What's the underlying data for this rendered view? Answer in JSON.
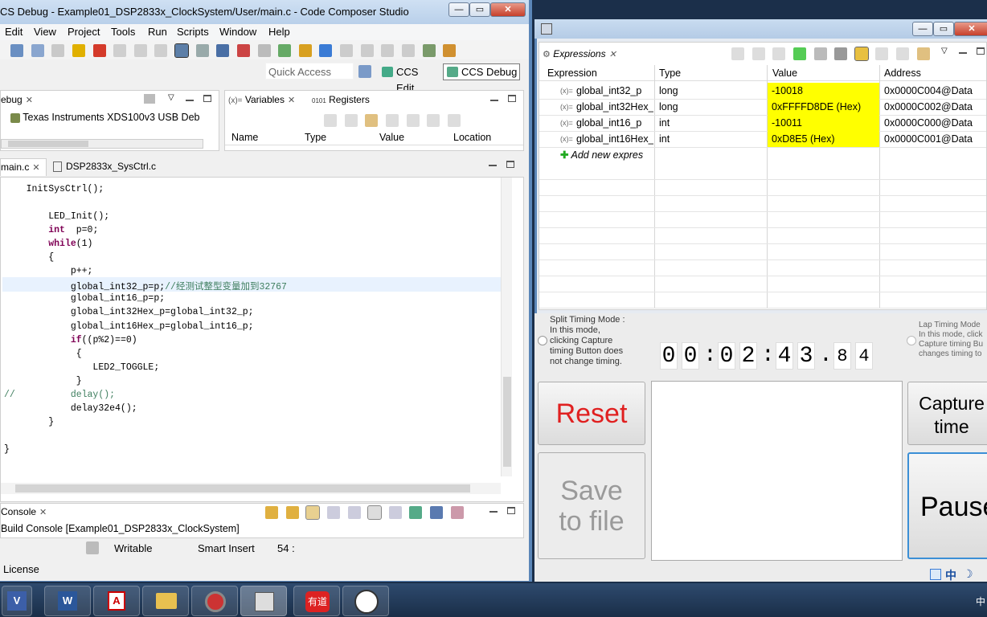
{
  "ccs": {
    "title": "CS Debug - Example01_DSP2833x_ClockSystem/User/main.c - Code Composer Studio",
    "menu": [
      "Edit",
      "View",
      "Project",
      "Tools",
      "Run",
      "Scripts",
      "Window",
      "Help"
    ],
    "quick_access": "Quick Access",
    "perspectives": [
      "CCS Edit",
      "CCS Debug"
    ],
    "debug_view": {
      "tab": "ebug",
      "target": "Texas Instruments XDS100v3 USB Deb"
    },
    "variables_view": {
      "tabs": [
        "Variables",
        "Registers"
      ],
      "columns": [
        "Name",
        "Type",
        "Value",
        "Location"
      ]
    },
    "editor": {
      "tabs": [
        "main.c",
        "DSP2833x_SysCtrl.c"
      ],
      "lines": [
        "    InitSysCtrl();",
        "",
        "        LED_Init();",
        "        int  p=0;",
        "        while(1)",
        "        {",
        "            p++;",
        "            global_int32_p=p;//经测试整型变量加到32767",
        "            global_int16_p=p;",
        "            global_int32Hex_p=global_int32_p;",
        "            global_int16Hex_p=global_int16_p;",
        "            if((p%2)==0)",
        "             {",
        "                LED2_TOGGLE;",
        "             }",
        "//          delay();",
        "            delay32e4();",
        "        }",
        "",
        "}"
      ]
    },
    "console": {
      "tab": "Console",
      "text": "Build Console [Example01_DSP2833x_ClockSystem]"
    },
    "status": {
      "writable": "Writable",
      "insert": "Smart Insert",
      "pos": "54 :",
      "license": "License"
    }
  },
  "expressions": {
    "tab": "Expressions",
    "columns": [
      "Expression",
      "Type",
      "Value",
      "Address"
    ],
    "rows": [
      {
        "name": "global_int32_p",
        "type": "long",
        "value": "-10018",
        "address": "0x0000C004@Data"
      },
      {
        "name": "global_int32Hex_",
        "type": "long",
        "value": "0xFFFFD8DE (Hex)",
        "address": "0x0000C002@Data"
      },
      {
        "name": "global_int16_p",
        "type": "int",
        "value": "-10011",
        "address": "0x0000C000@Data"
      },
      {
        "name": "global_int16Hex_",
        "type": "int",
        "value": "0xD8E5 (Hex)",
        "address": "0x0000C001@Data"
      }
    ],
    "add_new": "Add new expres",
    "var_prefix": "(x)="
  },
  "stopwatch": {
    "split_text": "Split Timing Mode :\nIn this mode,\nclicking Capture\ntiming Button does\nnot change timing.",
    "lap_text": "Lap Timing Mode\nIn this mode, click\nCapture timing Bu\nchanges timing to",
    "time_digits": [
      "0",
      "0",
      ":",
      "0",
      "2",
      ":",
      "4",
      "3",
      ".",
      "8",
      "4"
    ],
    "reset": "Reset",
    "save": "Save\nto file",
    "capture": "Capture\ntime",
    "pause": "Pause",
    "colors": {
      "reset": "#e02020",
      "disabled": "#9a9a9a"
    }
  },
  "tray": {
    "ime": "中"
  }
}
